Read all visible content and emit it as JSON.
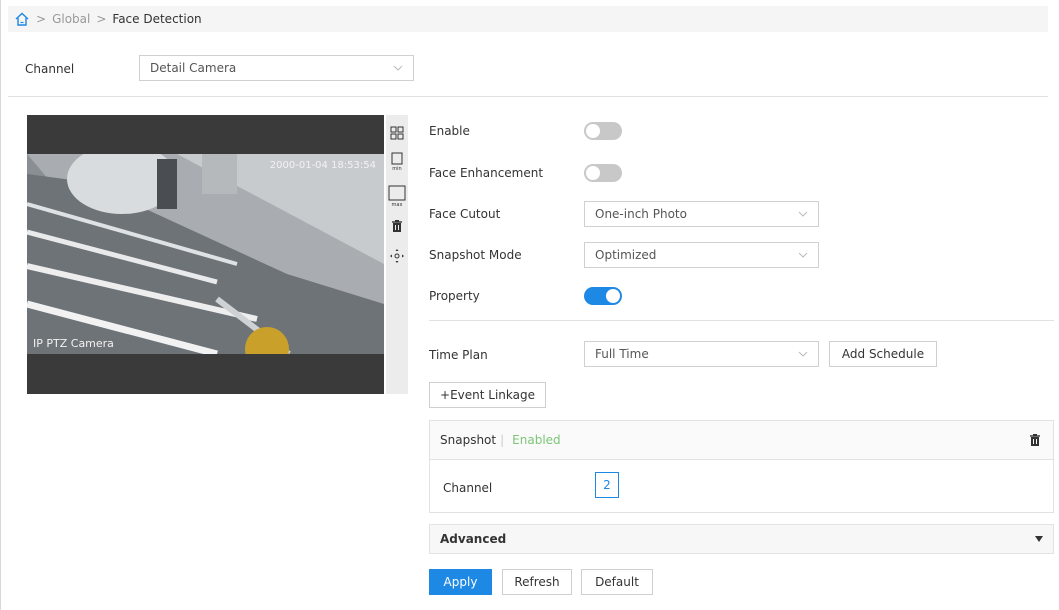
{
  "breadcrumb": {
    "items": [
      "Global",
      "Face Detection"
    ],
    "separator": ">"
  },
  "channel_bar": {
    "label": "Channel",
    "value": "Detail Camera"
  },
  "video": {
    "timestamp": "2000-01-04 18:53:54",
    "camera_name": "IP PTZ Camera"
  },
  "toolbar": {
    "icons": [
      "grid-icon",
      "min-rect-icon",
      "max-rect-icon",
      "trash-icon",
      "move-icon"
    ],
    "min_text": "min",
    "max_text": "max"
  },
  "form": {
    "enable_label": "Enable",
    "enable": false,
    "face_enhancement_label": "Face Enhancement",
    "face_enhancement": false,
    "face_cutout_label": "Face Cutout",
    "face_cutout_value": "One-inch Photo",
    "snapshot_mode_label": "Snapshot Mode",
    "snapshot_mode_value": "Optimized",
    "property_label": "Property",
    "property": true,
    "time_plan_label": "Time Plan",
    "time_plan_value": "Full Time",
    "add_schedule_label": "Add Schedule",
    "event_linkage_label": "+Event Linkage"
  },
  "snapshot": {
    "title": "Snapshot",
    "status": "Enabled",
    "channel_label": "Channel",
    "channel_value": "2"
  },
  "advanced": {
    "label": "Advanced"
  },
  "actions": {
    "apply": "Apply",
    "refresh": "Refresh",
    "default": "Default"
  },
  "colors": {
    "accent": "#1e88e5",
    "enabled_text": "#7cc576",
    "toggle_off": "#c8c8c8"
  }
}
